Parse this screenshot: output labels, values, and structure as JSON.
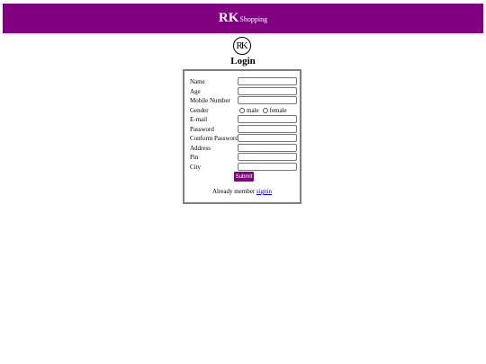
{
  "header": {
    "brand_main": "RK",
    "brand_sub": "Shopping",
    "background": "#800080"
  },
  "logo": {
    "text": "RK"
  },
  "page_title": "Login",
  "form": {
    "fields": [
      {
        "label": "Name",
        "value": ""
      },
      {
        "label": "Age",
        "value": ""
      },
      {
        "label": "Mobile Number",
        "value": ""
      },
      {
        "label": "Gender",
        "type": "radio",
        "options": [
          "male",
          "female"
        ]
      },
      {
        "label": "E-mail",
        "value": ""
      },
      {
        "label": "Password",
        "value": ""
      },
      {
        "label": "Conform Password",
        "value": ""
      },
      {
        "label": "Address",
        "value": ""
      },
      {
        "label": "Pin",
        "value": ""
      },
      {
        "label": "City",
        "value": ""
      }
    ],
    "submit_label": "Submit",
    "already_text": "Already member",
    "signin_link": "signin"
  }
}
